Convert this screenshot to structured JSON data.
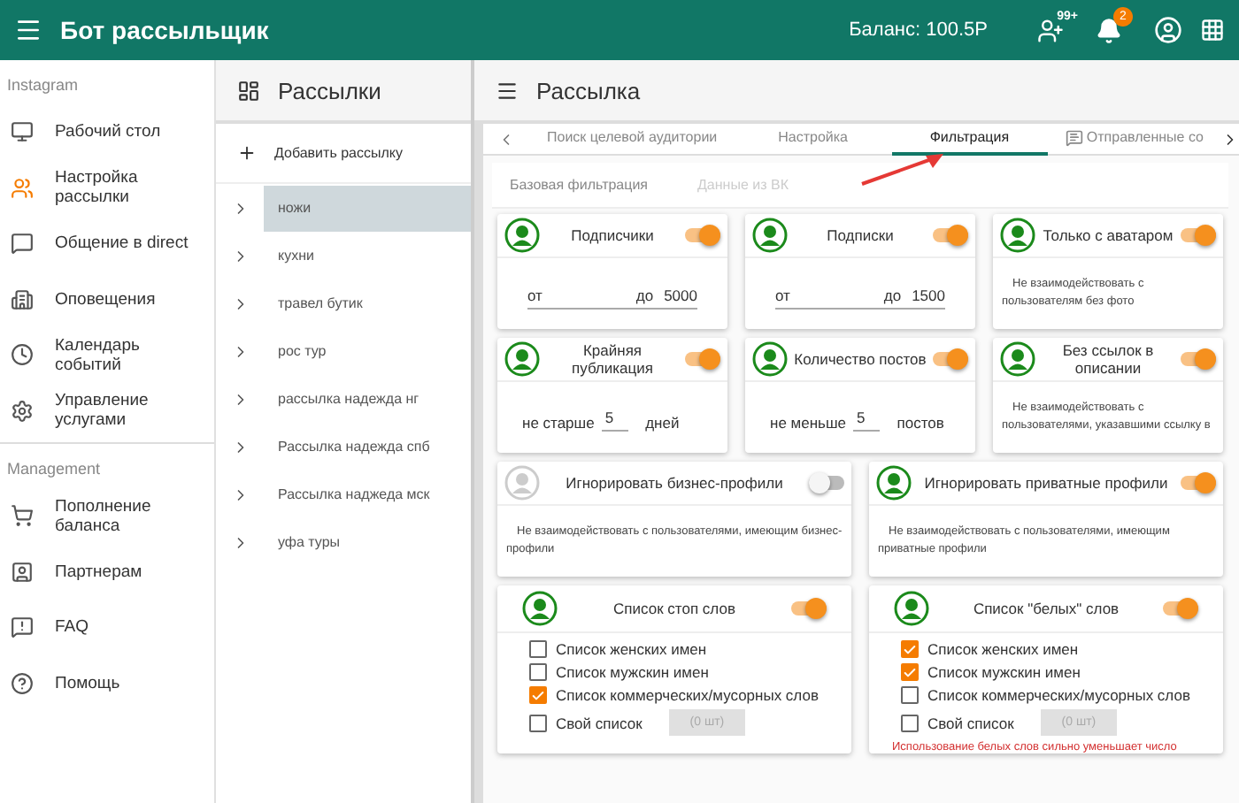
{
  "app": {
    "title": "Бот рассыльщик",
    "balance": "Баланс: 100.5Р",
    "invites_badge": "99+",
    "notifications_badge": "2"
  },
  "sidebar": {
    "sections": [
      {
        "label": "Instagram",
        "items": [
          {
            "label": "Рабочий стол",
            "selected": false
          },
          {
            "label": "Настройка рассылки",
            "selected": true
          },
          {
            "label": "Общение в direct",
            "selected": false
          },
          {
            "label": "Оповещения",
            "selected": false
          },
          {
            "label": "Календарь событий",
            "selected": false
          },
          {
            "label": "Управление услугами",
            "selected": false
          }
        ]
      },
      {
        "label": "Management",
        "items": [
          {
            "label": "Пополнение баланса",
            "selected": false
          },
          {
            "label": "Партнерам",
            "selected": false
          },
          {
            "label": "FAQ",
            "selected": false
          },
          {
            "label": "Помощь",
            "selected": false
          }
        ]
      }
    ]
  },
  "mailings": {
    "title": "Рассылки",
    "add_label": "Добавить рассылку",
    "items": [
      {
        "label": "ножи",
        "selected": true
      },
      {
        "label": "кухни",
        "selected": false
      },
      {
        "label": "травел бутик",
        "selected": false
      },
      {
        "label": "рос тур",
        "selected": false
      },
      {
        "label": "рассылка надежда нг",
        "selected": false
      },
      {
        "label": "Рассылка надежда спб",
        "selected": false
      },
      {
        "label": "Рассылка наджеда мск",
        "selected": false
      },
      {
        "label": "уфа туры",
        "selected": false
      }
    ]
  },
  "main": {
    "title": "Рассылка",
    "tabs": [
      {
        "label": "Поиск целевой аудитории",
        "selected": false
      },
      {
        "label": "Настройка",
        "selected": false
      },
      {
        "label": "Фильтрация",
        "selected": true
      },
      {
        "label": "Отправленные со",
        "selected": false
      }
    ],
    "subtabs": [
      {
        "label": "Базовая фильтрация",
        "disabled": false
      },
      {
        "label": "Данные из ВК",
        "disabled": true
      }
    ],
    "rows": [
      [
        {
          "kind": "range",
          "title": "Подписчики",
          "on": true,
          "from_label": "от",
          "to_label": "до",
          "to_value": "5000"
        },
        {
          "kind": "range",
          "title": "Подписки",
          "on": true,
          "from_label": "от",
          "to_label": "до",
          "to_value": "1500"
        },
        {
          "kind": "note",
          "title": "Только с аватаром",
          "on": true,
          "text": "Не взаимодействовать с пользователям без фото"
        }
      ],
      [
        {
          "kind": "period",
          "title": "Крайняя публикация",
          "on": true,
          "prefix": "не старше",
          "value": "5",
          "suffix": "дней"
        },
        {
          "kind": "period",
          "title": "Количество постов",
          "on": true,
          "prefix": "не меньше",
          "value": "5",
          "suffix": "постов"
        },
        {
          "kind": "note",
          "title": "Без ссылок в описании",
          "on": true,
          "text": "Не взаимодействовать с пользователями, указавшими ссылку в"
        }
      ],
      [
        {
          "kind": "note",
          "title": "Игнорировать бизнес-профили",
          "on": false,
          "text": "Не взаимодействовать с пользователями, имеющим бизнес-профили"
        },
        {
          "kind": "note",
          "title": "Игнорировать приватные профили",
          "on": true,
          "text": "Не взаимодействовать с пользователями, имеющим приватные профили"
        }
      ],
      [
        {
          "kind": "list",
          "title": "Список стоп слов",
          "on": true,
          "items": [
            {
              "label": "Список женских имен",
              "checked": false
            },
            {
              "label": "Список мужскин имен",
              "checked": false
            },
            {
              "label": "Список коммерческих/мусорных слов",
              "checked": true
            },
            {
              "label": "Свой список",
              "checked": false,
              "count": "(0 шт)"
            }
          ]
        },
        {
          "kind": "list",
          "title": "Список \"белых\" слов",
          "on": true,
          "items": [
            {
              "label": "Список женских имен",
              "checked": true
            },
            {
              "label": "Список мужскин имен",
              "checked": true
            },
            {
              "label": "Список коммерческих/мусорных слов",
              "checked": false
            },
            {
              "label": "Свой список",
              "checked": false,
              "count": "(0 шт)"
            }
          ],
          "warning": "Использование белых слов сильно уменьшает число"
        }
      ]
    ]
  }
}
